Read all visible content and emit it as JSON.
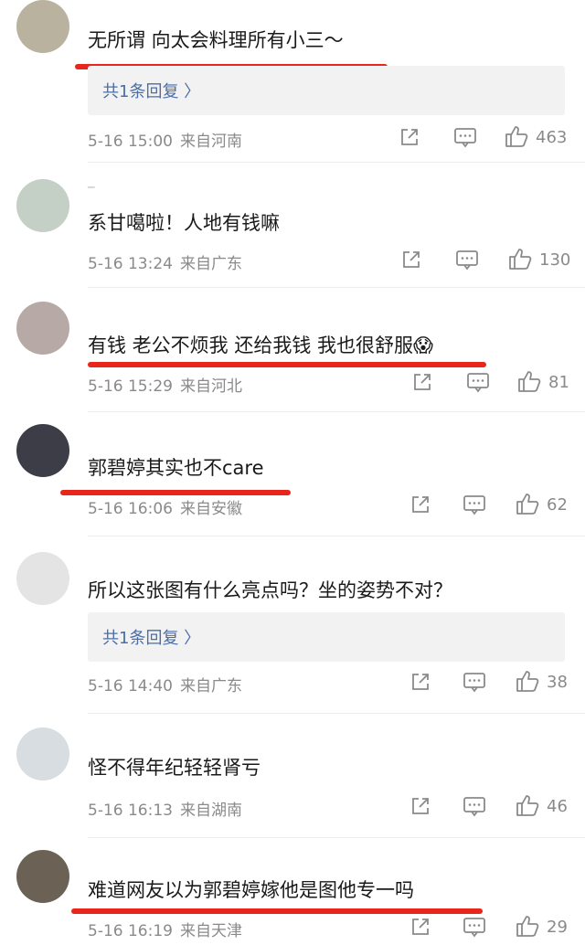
{
  "comments": [
    {
      "nickname": "",
      "text": "无所谓 向太会料理所有小三～",
      "reply": "共1条回复 〉",
      "date": "5-16 15:00",
      "location": "来自河南",
      "likes": "463",
      "avatar_color": "#b9b29f"
    },
    {
      "nickname": "_",
      "text": "系甘噶啦！人地有钱嘛",
      "reply": "",
      "date": "5-16 13:24",
      "location": "来自广东",
      "likes": "130",
      "avatar_color": "#c4cfc6"
    },
    {
      "nickname": "",
      "text": "有钱 老公不烦我 还给我钱 我也很舒服😱",
      "reply": "",
      "date": "5-16 15:29",
      "location": "来自河北",
      "likes": "81",
      "avatar_color": "#b7aaa6"
    },
    {
      "nickname": "",
      "text": "郭碧婷其实也不care",
      "reply": "",
      "date": "5-16 16:06",
      "location": "来自安徽",
      "likes": "62",
      "avatar_color": "#3d3d47"
    },
    {
      "nickname": "",
      "text": "所以这张图有什么亮点吗？坐的姿势不对？",
      "reply": "共1条回复 〉",
      "date": "5-16 14:40",
      "location": "来自广东",
      "likes": "38",
      "avatar_color": "#e4e4e4"
    },
    {
      "nickname": "",
      "text": "怪不得年纪轻轻肾亏",
      "reply": "",
      "date": "5-16 16:13",
      "location": "来自湖南",
      "likes": "46",
      "avatar_color": "#d7dde0"
    },
    {
      "nickname": "",
      "text": "难道网友以为郭碧婷嫁他是图他专一吗",
      "reply": "",
      "date": "5-16 16:19",
      "location": "来自天津",
      "likes": "29",
      "avatar_color": "#6b6255"
    }
  ],
  "icons": {
    "share": "share-icon",
    "comment": "comment-icon",
    "like": "thumbs-up-icon"
  },
  "colors": {
    "underline": "#e8261b",
    "reply_link": "#4a6ea8",
    "meta": "#8a8a8a"
  }
}
